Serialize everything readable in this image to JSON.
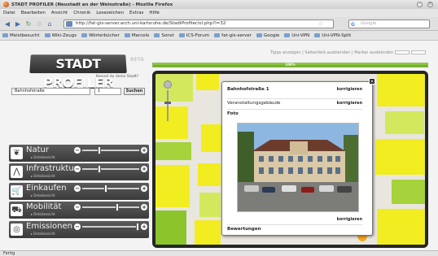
{
  "window": {
    "title": "STADT PROFILER (Neustadt an der Weinstraße) - Mozilla Firefox"
  },
  "menu": [
    "Datei",
    "Bearbeiten",
    "Ansicht",
    "Chronik",
    "Lesezeichen",
    "Extras",
    "Hilfe"
  ],
  "nav": {
    "url": "http://fat-gis-server.arch.uni-karlsruhe.de/StadtProfiler/ol.php?l=32",
    "search_placeholder": "Google"
  },
  "bookmarks": [
    "Meistbesucht",
    "Wiki-Zeugs",
    "Wörterbücher",
    "Marcelo",
    "Sonst",
    "ICS-Forum",
    "fat-gis-server",
    "Google",
    "Uni-VPN",
    "Uni-VPN-Split"
  ],
  "header": {
    "logo": "STADT PROFILER",
    "beta": "BETA",
    "subtitle": "Kennst du deine Stadt?",
    "links": "Tipps anzeigen | Seitenfeld ausblenden | Marker ausblenden",
    "progress_label": "100%",
    "progress_value": 1.0
  },
  "search": {
    "street": "Bahnhofstraße",
    "number": "1",
    "button": "Suchen"
  },
  "criteria": [
    {
      "label": "Natur",
      "detail": "▸ Detailansicht",
      "icon": "leaf-icon",
      "glyph": "❦",
      "value": 0.3
    },
    {
      "label": "Infrastruktur",
      "detail": "▸ Detailansicht",
      "icon": "road-icon",
      "glyph": "⋀",
      "value": 0.3
    },
    {
      "label": "Einkaufen",
      "detail": "▸ Detailansicht",
      "icon": "cart-icon",
      "glyph": "🛒",
      "value": 0.42
    },
    {
      "label": "Mobilität",
      "detail": "▸ Detailansicht",
      "icon": "car-icon",
      "glyph": "⛟",
      "value": 0.62
    },
    {
      "label": "Emissionen",
      "detail": "▸ Detailansicht",
      "icon": "headphones-icon",
      "glyph": "◎",
      "value": 0.97
    }
  ],
  "popup": {
    "title": "Bahnhofstraße 1",
    "row2": "Veranstaltungsgebäude",
    "korrigieren": "korrigieren",
    "foto": "Foto",
    "bewertungen": "Bewertungen"
  },
  "status": "Fertig",
  "colors": {
    "accent_green": "#7bc12f",
    "map_yellow": "#f2ed20",
    "panel_dark": "#444444"
  }
}
